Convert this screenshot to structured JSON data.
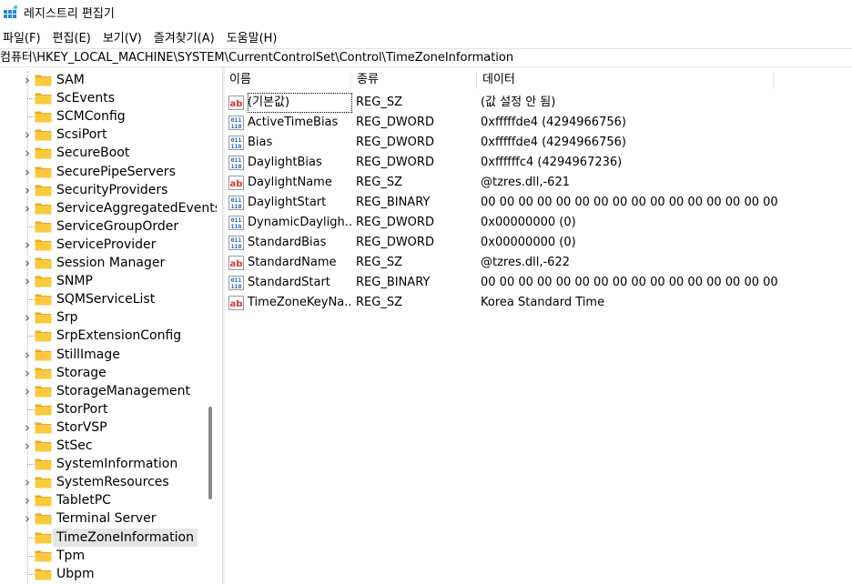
{
  "window": {
    "title": "레지스트리 편집기",
    "icon": "regedit-icon"
  },
  "menu": [
    "파일(F)",
    "편집(E)",
    "보기(V)",
    "즐겨찾기(A)",
    "도움말(H)"
  ],
  "address": "컴퓨터\\HKEY_LOCAL_MACHINE\\SYSTEM\\CurrentControlSet\\Control\\TimeZoneInformation",
  "tree": {
    "items": [
      {
        "label": "SAM",
        "expandable": true
      },
      {
        "label": "ScEvents",
        "expandable": false
      },
      {
        "label": "SCMConfig",
        "expandable": false
      },
      {
        "label": "ScsiPort",
        "expandable": true
      },
      {
        "label": "SecureBoot",
        "expandable": true
      },
      {
        "label": "SecurePipeServers",
        "expandable": true
      },
      {
        "label": "SecurityProviders",
        "expandable": true
      },
      {
        "label": "ServiceAggregatedEvents",
        "expandable": true
      },
      {
        "label": "ServiceGroupOrder",
        "expandable": false
      },
      {
        "label": "ServiceProvider",
        "expandable": true
      },
      {
        "label": "Session Manager",
        "expandable": true
      },
      {
        "label": "SNMP",
        "expandable": true
      },
      {
        "label": "SQMServiceList",
        "expandable": false
      },
      {
        "label": "Srp",
        "expandable": true
      },
      {
        "label": "SrpExtensionConfig",
        "expandable": false
      },
      {
        "label": "StillImage",
        "expandable": true
      },
      {
        "label": "Storage",
        "expandable": true
      },
      {
        "label": "StorageManagement",
        "expandable": true
      },
      {
        "label": "StorPort",
        "expandable": false
      },
      {
        "label": "StorVSP",
        "expandable": true
      },
      {
        "label": "StSec",
        "expandable": true
      },
      {
        "label": "SystemInformation",
        "expandable": false
      },
      {
        "label": "SystemResources",
        "expandable": true
      },
      {
        "label": "TabletPC",
        "expandable": true
      },
      {
        "label": "Terminal Server",
        "expandable": true
      },
      {
        "label": "TimeZoneInformation",
        "expandable": false,
        "selected": true
      },
      {
        "label": "Tpm",
        "expandable": false
      },
      {
        "label": "Ubpm",
        "expandable": false
      }
    ]
  },
  "list": {
    "headers": {
      "name": "이름",
      "type": "종류",
      "data": "데이터"
    },
    "rows": [
      {
        "icon": "string-value-icon",
        "name": "(기본값)",
        "type": "REG_SZ",
        "data": "(값 설정 안 됨)"
      },
      {
        "icon": "binary-value-icon",
        "name": "ActiveTimeBias",
        "type": "REG_DWORD",
        "data": "0xfffffde4 (4294966756)"
      },
      {
        "icon": "binary-value-icon",
        "name": "Bias",
        "type": "REG_DWORD",
        "data": "0xfffffde4 (4294966756)"
      },
      {
        "icon": "binary-value-icon",
        "name": "DaylightBias",
        "type": "REG_DWORD",
        "data": "0xffffffc4 (4294967236)"
      },
      {
        "icon": "string-value-icon",
        "name": "DaylightName",
        "type": "REG_SZ",
        "data": "@tzres.dll,-621"
      },
      {
        "icon": "binary-value-icon",
        "name": "DaylightStart",
        "type": "REG_BINARY",
        "data": "00 00 00 00 00 00 00 00 00 00 00 00 00 00 00 00"
      },
      {
        "icon": "binary-value-icon",
        "name": "DynamicDayligh...",
        "type": "REG_DWORD",
        "data": "0x00000000 (0)"
      },
      {
        "icon": "binary-value-icon",
        "name": "StandardBias",
        "type": "REG_DWORD",
        "data": "0x00000000 (0)"
      },
      {
        "icon": "string-value-icon",
        "name": "StandardName",
        "type": "REG_SZ",
        "data": "@tzres.dll,-622"
      },
      {
        "icon": "binary-value-icon",
        "name": "StandardStart",
        "type": "REG_BINARY",
        "data": "00 00 00 00 00 00 00 00 00 00 00 00 00 00 00 00"
      },
      {
        "icon": "string-value-icon",
        "name": "TimeZoneKeyNa...",
        "type": "REG_SZ",
        "data": "Korea Standard Time"
      }
    ]
  }
}
